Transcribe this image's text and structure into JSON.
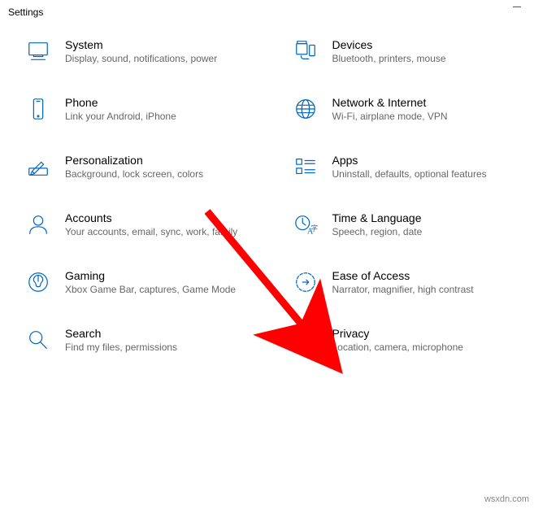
{
  "window": {
    "title": "Settings"
  },
  "accent": "#0067c0",
  "categories": [
    {
      "id": "system",
      "title": "System",
      "desc": "Display, sound, notifications, power"
    },
    {
      "id": "devices",
      "title": "Devices",
      "desc": "Bluetooth, printers, mouse"
    },
    {
      "id": "phone",
      "title": "Phone",
      "desc": "Link your Android, iPhone"
    },
    {
      "id": "network",
      "title": "Network & Internet",
      "desc": "Wi-Fi, airplane mode, VPN"
    },
    {
      "id": "personalization",
      "title": "Personalization",
      "desc": "Background, lock screen, colors"
    },
    {
      "id": "apps",
      "title": "Apps",
      "desc": "Uninstall, defaults, optional features"
    },
    {
      "id": "accounts",
      "title": "Accounts",
      "desc": "Your accounts, email, sync, work, family"
    },
    {
      "id": "time-language",
      "title": "Time & Language",
      "desc": "Speech, region, date"
    },
    {
      "id": "gaming",
      "title": "Gaming",
      "desc": "Xbox Game Bar, captures, Game Mode"
    },
    {
      "id": "ease-of-access",
      "title": "Ease of Access",
      "desc": "Narrator, magnifier, high contrast"
    },
    {
      "id": "search",
      "title": "Search",
      "desc": "Find my files, permissions"
    },
    {
      "id": "privacy",
      "title": "Privacy",
      "desc": "Location, camera, microphone"
    }
  ],
  "annotation": {
    "arrow_target": "ease-of-access",
    "arrow_color": "#ff0000"
  },
  "watermark": "wsxdn.com"
}
